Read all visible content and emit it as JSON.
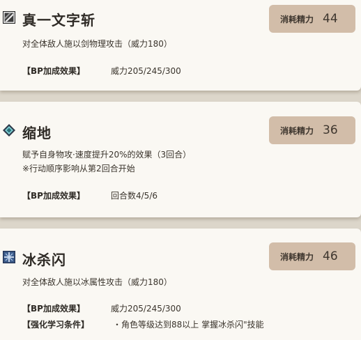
{
  "skills": [
    {
      "name": "真一文字斩",
      "icon": "sword-slash-icon",
      "cost_label": "消耗精力",
      "cost": "44",
      "description_lines": [
        "对全体敌人施以剑物理攻击（威力180）"
      ],
      "bp_label": "【BP加成效果】",
      "bp_value": "威力205/245/300"
    },
    {
      "name": "缩地",
      "icon": "diamond-gem-icon",
      "cost_label": "消耗精力",
      "cost": "36",
      "description_lines": [
        "赋予自身物攻·速度提升20%的效果（3回合）",
        "※行动顺序影响从第2回合开始"
      ],
      "bp_label": "【BP加成效果】",
      "bp_value": "回合数4/5/6"
    },
    {
      "name": "冰杀闪",
      "icon": "ice-crystal-icon",
      "cost_label": "消耗精力",
      "cost": "46",
      "description_lines": [
        "对全体敌人施以冰属性攻击（威力180）"
      ],
      "bp_label": "【BP加成效果】",
      "bp_value": "威力205/245/300",
      "learn_label": "【强化学习条件】",
      "learn_value": "・角色等级达到88以上 掌握冰杀闪\"技能"
    }
  ],
  "colors": {
    "background": "#dcd6ca",
    "card": "#faf8f3",
    "cost_button": "#d2bda9",
    "text": "#3a342c"
  }
}
